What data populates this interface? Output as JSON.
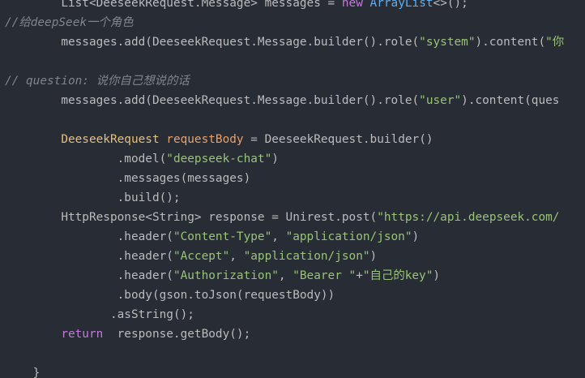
{
  "colors": {
    "background": "#282c34",
    "plain": "#bbbbbb",
    "string": "#98c379",
    "keyword": "#c678dd",
    "type": "#e5c07b",
    "variable": "#e8a06b",
    "classname": "#61afef",
    "comment": "#7f848e"
  },
  "code_lines": [
    {
      "indent": "        ",
      "tokens": [
        {
          "t": "List<DeeseekRequest.Message> messages = ",
          "c": "plain"
        },
        {
          "t": "new",
          "c": "keyword"
        },
        {
          "t": " ",
          "c": "plain"
        },
        {
          "t": "ArrayList",
          "c": "classname"
        },
        {
          "t": "<>();",
          "c": "plain"
        }
      ]
    },
    {
      "indent": "",
      "tokens": [
        {
          "t": "//给deepSeek一个角色",
          "c": "comment"
        }
      ]
    },
    {
      "indent": "        ",
      "tokens": [
        {
          "t": "messages.add(DeeseekRequest.Message.builder().role(",
          "c": "plain"
        },
        {
          "t": "\"system\"",
          "c": "string"
        },
        {
          "t": ").content(",
          "c": "plain"
        },
        {
          "t": "\"你",
          "c": "string"
        }
      ]
    },
    {
      "indent": "",
      "tokens": []
    },
    {
      "indent": "",
      "tokens": [
        {
          "t": "// question: 说你自己想说的话",
          "c": "comment"
        }
      ]
    },
    {
      "indent": "        ",
      "tokens": [
        {
          "t": "messages.add(DeeseekRequest.Message.builder().role(",
          "c": "plain"
        },
        {
          "t": "\"user\"",
          "c": "string"
        },
        {
          "t": ").content(ques",
          "c": "plain"
        }
      ]
    },
    {
      "indent": "",
      "tokens": []
    },
    {
      "indent": "        ",
      "tokens": [
        {
          "t": "DeeseekRequest",
          "c": "type"
        },
        {
          "t": " ",
          "c": "plain"
        },
        {
          "t": "requestBody",
          "c": "variable"
        },
        {
          "t": " = DeeseekRequest.builder()",
          "c": "plain"
        }
      ]
    },
    {
      "indent": "                ",
      "tokens": [
        {
          "t": ".model(",
          "c": "plain"
        },
        {
          "t": "\"deepseek-chat\"",
          "c": "string"
        },
        {
          "t": ")",
          "c": "plain"
        }
      ]
    },
    {
      "indent": "                ",
      "tokens": [
        {
          "t": ".messages(messages)",
          "c": "plain"
        }
      ]
    },
    {
      "indent": "                ",
      "tokens": [
        {
          "t": ".build();",
          "c": "plain"
        }
      ]
    },
    {
      "indent": "        ",
      "tokens": [
        {
          "t": "HttpResponse<String> response = Unirest.post(",
          "c": "plain"
        },
        {
          "t": "\"https://api.deepseek.com/",
          "c": "string"
        }
      ]
    },
    {
      "indent": "                ",
      "tokens": [
        {
          "t": ".header(",
          "c": "plain"
        },
        {
          "t": "\"Content-Type\"",
          "c": "string"
        },
        {
          "t": ", ",
          "c": "plain"
        },
        {
          "t": "\"application/json\"",
          "c": "string"
        },
        {
          "t": ")",
          "c": "plain"
        }
      ]
    },
    {
      "indent": "                ",
      "tokens": [
        {
          "t": ".header(",
          "c": "plain"
        },
        {
          "t": "\"Accept\"",
          "c": "string"
        },
        {
          "t": ", ",
          "c": "plain"
        },
        {
          "t": "\"application/json\"",
          "c": "string"
        },
        {
          "t": ")",
          "c": "plain"
        }
      ]
    },
    {
      "indent": "                ",
      "tokens": [
        {
          "t": ".header(",
          "c": "plain"
        },
        {
          "t": "\"Authorization\"",
          "c": "string"
        },
        {
          "t": ", ",
          "c": "plain"
        },
        {
          "t": "\"Bearer \"",
          "c": "string"
        },
        {
          "t": "+",
          "c": "plain"
        },
        {
          "t": "\"自己的key\"",
          "c": "string"
        },
        {
          "t": ")",
          "c": "plain"
        }
      ]
    },
    {
      "indent": "                ",
      "tokens": [
        {
          "t": ".body(gson.toJson(requestBody))",
          "c": "plain"
        }
      ]
    },
    {
      "indent": "               ",
      "tokens": [
        {
          "t": ".asString();",
          "c": "plain"
        }
      ]
    },
    {
      "indent": "        ",
      "tokens": [
        {
          "t": "return",
          "c": "keyword"
        },
        {
          "t": "  response.getBody();",
          "c": "plain"
        }
      ]
    },
    {
      "indent": "",
      "tokens": []
    },
    {
      "indent": "    ",
      "tokens": [
        {
          "t": "}",
          "c": "plain"
        }
      ]
    }
  ]
}
